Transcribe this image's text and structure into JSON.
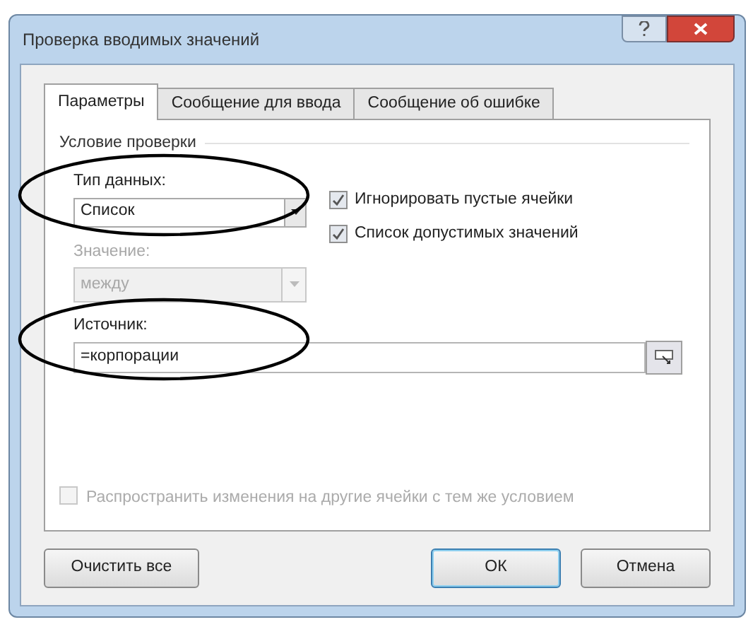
{
  "window": {
    "title": "Проверка вводимых значений"
  },
  "tabs": [
    {
      "label": "Параметры",
      "selected": true
    },
    {
      "label": "Сообщение для ввода",
      "selected": false
    },
    {
      "label": "Сообщение об ошибке",
      "selected": false
    }
  ],
  "group_title": "Условие проверки",
  "data_type": {
    "label": "Тип данных:",
    "value": "Список",
    "highlighted": true
  },
  "checkboxes": [
    {
      "label": "Игнорировать пустые ячейки",
      "checked": true
    },
    {
      "label": "Список допустимых значений",
      "checked": true
    }
  ],
  "value_field": {
    "label": "Значение:",
    "value": "между",
    "disabled": true
  },
  "source": {
    "label": "Источник:",
    "value": "=корпорации",
    "highlighted": true
  },
  "apply_all": {
    "label": "Распространить изменения на другие ячейки с тем же условием",
    "checked": false,
    "disabled": true
  },
  "buttons": [
    {
      "label": "Очистить все",
      "default": false
    },
    {
      "label": "ОК",
      "default": true
    },
    {
      "label": "Отмена",
      "default": false
    }
  ]
}
